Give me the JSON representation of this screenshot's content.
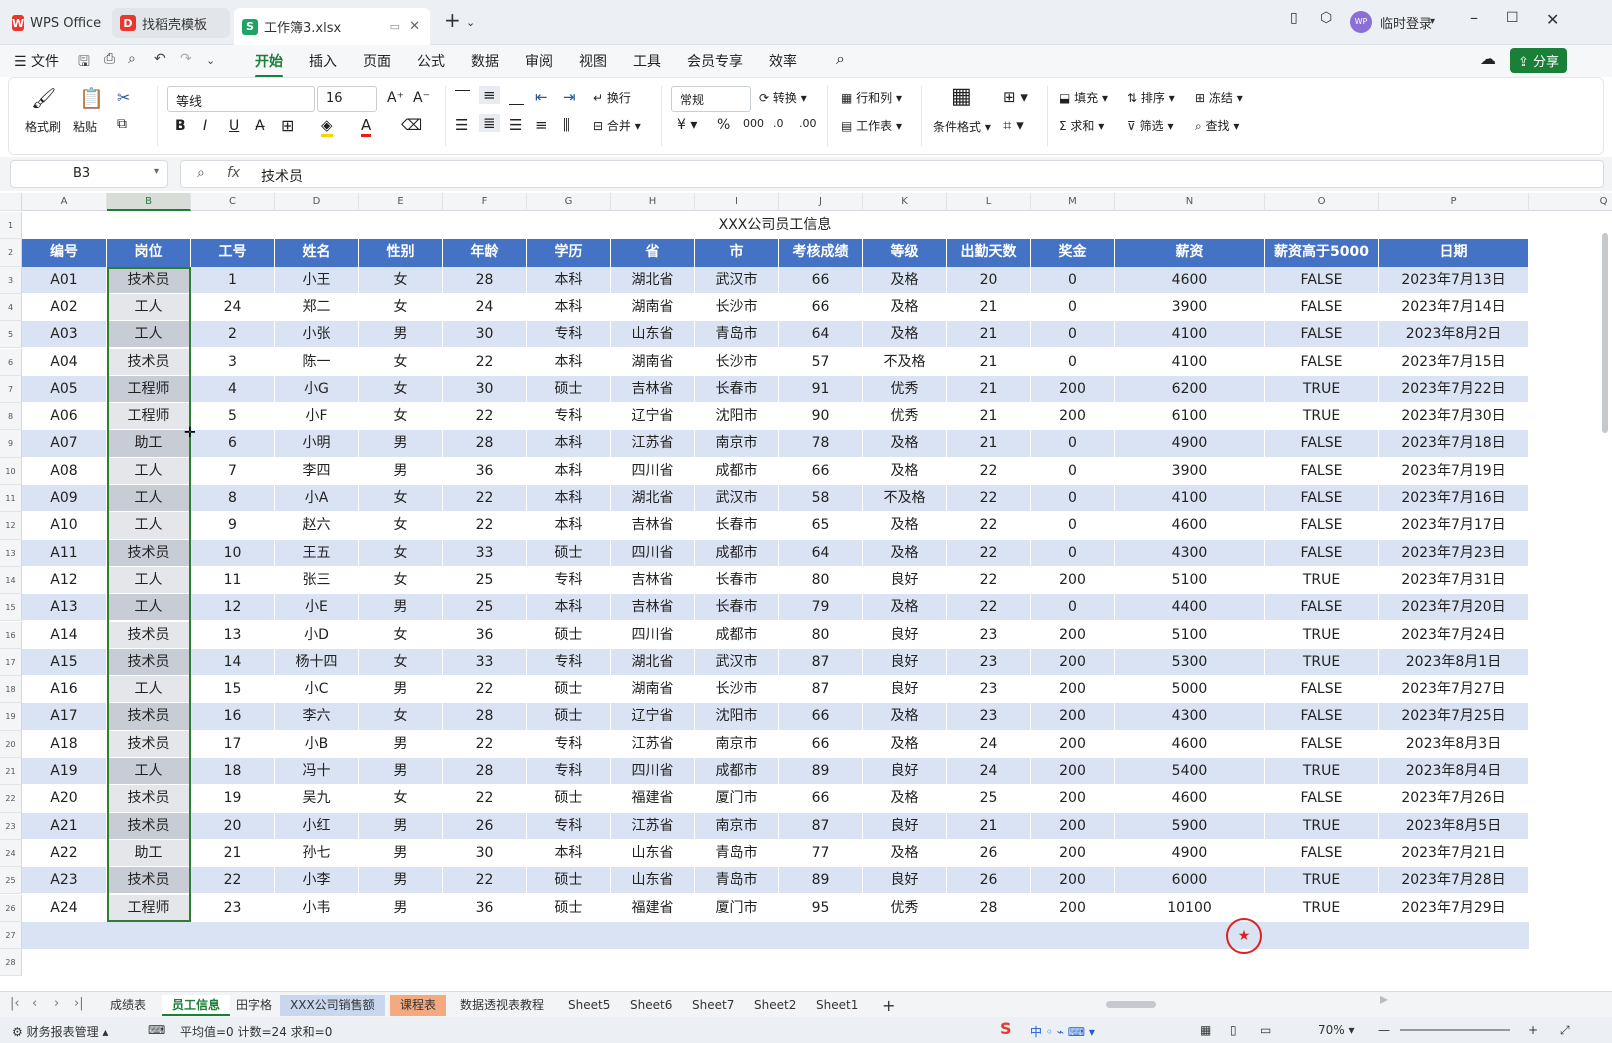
{
  "window": {
    "tabs": [
      {
        "label": "WPS Office",
        "icon": "wps-logo"
      },
      {
        "label": "找稻壳模板",
        "icon": "docer-logo"
      },
      {
        "label": "工作簿3.xlsx",
        "icon": "spreadsheet-logo",
        "active": true
      }
    ],
    "user_label": "临时登录",
    "avatar_text": "WP"
  },
  "menu": {
    "file_label": "文件",
    "items": [
      "开始",
      "插入",
      "页面",
      "公式",
      "数据",
      "审阅",
      "视图",
      "工具",
      "会员专享",
      "效率"
    ],
    "active": "开始",
    "share_label": "分享"
  },
  "ribbon": {
    "format_painter": "格式刷",
    "paste": "粘贴",
    "font_name": "等线",
    "font_size": "16",
    "wrap": "换行",
    "merge": "合并",
    "number_format": "常规",
    "convert": "转换",
    "rows_cols": "行和列",
    "worksheet": "工作表",
    "cond_format": "条件格式",
    "fill": "填充",
    "sort": "排序",
    "freeze": "冻结",
    "sum": "求和",
    "filter": "筛选",
    "find": "查找"
  },
  "formula": {
    "cell_ref": "B3",
    "fx_label": "fx",
    "value": "技术员"
  },
  "columns": [
    "A",
    "B",
    "C",
    "D",
    "E",
    "F",
    "G",
    "H",
    "I",
    "J",
    "K",
    "L",
    "M",
    "N",
    "O",
    "P",
    "Q"
  ],
  "sheet": {
    "title": "XXX公司员工信息",
    "headers": [
      "编号",
      "岗位",
      "工号",
      "姓名",
      "性别",
      "年龄",
      "学历",
      "省",
      "市",
      "考核成绩",
      "等级",
      "出勤天数",
      "奖金",
      "薪资",
      "薪资高于5000",
      "日期"
    ],
    "rows": [
      [
        "A01",
        "技术员",
        "1",
        "小王",
        "女",
        "28",
        "本科",
        "湖北省",
        "武汉市",
        "66",
        "及格",
        "20",
        "0",
        "4600",
        "FALSE",
        "2023年7月13日"
      ],
      [
        "A02",
        "工人",
        "24",
        "郑二",
        "女",
        "24",
        "本科",
        "湖南省",
        "长沙市",
        "66",
        "及格",
        "21",
        "0",
        "3900",
        "FALSE",
        "2023年7月14日"
      ],
      [
        "A03",
        "工人",
        "2",
        "小张",
        "男",
        "30",
        "专科",
        "山东省",
        "青岛市",
        "64",
        "及格",
        "21",
        "0",
        "4100",
        "FALSE",
        "2023年8月2日"
      ],
      [
        "A04",
        "技术员",
        "3",
        "陈一",
        "女",
        "22",
        "本科",
        "湖南省",
        "长沙市",
        "57",
        "不及格",
        "21",
        "0",
        "4100",
        "FALSE",
        "2023年7月15日"
      ],
      [
        "A05",
        "工程师",
        "4",
        "小G",
        "女",
        "30",
        "硕士",
        "吉林省",
        "长春市",
        "91",
        "优秀",
        "21",
        "200",
        "6200",
        "TRUE",
        "2023年7月22日"
      ],
      [
        "A06",
        "工程师",
        "5",
        "小F",
        "女",
        "22",
        "专科",
        "辽宁省",
        "沈阳市",
        "90",
        "优秀",
        "21",
        "200",
        "6100",
        "TRUE",
        "2023年7月30日"
      ],
      [
        "A07",
        "助工",
        "6",
        "小明",
        "男",
        "28",
        "本科",
        "江苏省",
        "南京市",
        "78",
        "及格",
        "21",
        "0",
        "4900",
        "FALSE",
        "2023年7月18日"
      ],
      [
        "A08",
        "工人",
        "7",
        "李四",
        "男",
        "36",
        "本科",
        "四川省",
        "成都市",
        "66",
        "及格",
        "22",
        "0",
        "3900",
        "FALSE",
        "2023年7月19日"
      ],
      [
        "A09",
        "工人",
        "8",
        "小A",
        "女",
        "22",
        "本科",
        "湖北省",
        "武汉市",
        "58",
        "不及格",
        "22",
        "0",
        "4100",
        "FALSE",
        "2023年7月16日"
      ],
      [
        "A10",
        "工人",
        "9",
        "赵六",
        "女",
        "22",
        "本科",
        "吉林省",
        "长春市",
        "65",
        "及格",
        "22",
        "0",
        "4600",
        "FALSE",
        "2023年7月17日"
      ],
      [
        "A11",
        "技术员",
        "10",
        "王五",
        "女",
        "33",
        "硕士",
        "四川省",
        "成都市",
        "64",
        "及格",
        "22",
        "0",
        "4300",
        "FALSE",
        "2023年7月23日"
      ],
      [
        "A12",
        "工人",
        "11",
        "张三",
        "女",
        "25",
        "专科",
        "吉林省",
        "长春市",
        "80",
        "良好",
        "22",
        "200",
        "5100",
        "TRUE",
        "2023年7月31日"
      ],
      [
        "A13",
        "工人",
        "12",
        "小E",
        "男",
        "25",
        "本科",
        "吉林省",
        "长春市",
        "79",
        "及格",
        "22",
        "0",
        "4400",
        "FALSE",
        "2023年7月20日"
      ],
      [
        "A14",
        "技术员",
        "13",
        "小D",
        "女",
        "36",
        "硕士",
        "四川省",
        "成都市",
        "80",
        "良好",
        "23",
        "200",
        "5100",
        "TRUE",
        "2023年7月24日"
      ],
      [
        "A15",
        "技术员",
        "14",
        "杨十四",
        "女",
        "33",
        "专科",
        "湖北省",
        "武汉市",
        "87",
        "良好",
        "23",
        "200",
        "5300",
        "TRUE",
        "2023年8月1日"
      ],
      [
        "A16",
        "工人",
        "15",
        "小C",
        "男",
        "22",
        "硕士",
        "湖南省",
        "长沙市",
        "87",
        "良好",
        "23",
        "200",
        "5000",
        "FALSE",
        "2023年7月27日"
      ],
      [
        "A17",
        "技术员",
        "16",
        "李六",
        "女",
        "28",
        "硕士",
        "辽宁省",
        "沈阳市",
        "66",
        "及格",
        "23",
        "200",
        "4300",
        "FALSE",
        "2023年7月25日"
      ],
      [
        "A18",
        "技术员",
        "17",
        "小B",
        "男",
        "22",
        "专科",
        "江苏省",
        "南京市",
        "66",
        "及格",
        "24",
        "200",
        "4600",
        "FALSE",
        "2023年8月3日"
      ],
      [
        "A19",
        "工人",
        "18",
        "冯十",
        "男",
        "28",
        "专科",
        "四川省",
        "成都市",
        "89",
        "良好",
        "24",
        "200",
        "5400",
        "TRUE",
        "2023年8月4日"
      ],
      [
        "A20",
        "技术员",
        "19",
        "吴九",
        "女",
        "22",
        "硕士",
        "福建省",
        "厦门市",
        "66",
        "及格",
        "25",
        "200",
        "4600",
        "FALSE",
        "2023年7月26日"
      ],
      [
        "A21",
        "技术员",
        "20",
        "小红",
        "男",
        "26",
        "专科",
        "江苏省",
        "南京市",
        "87",
        "良好",
        "21",
        "200",
        "5900",
        "TRUE",
        "2023年8月5日"
      ],
      [
        "A22",
        "助工",
        "21",
        "孙七",
        "男",
        "30",
        "本科",
        "山东省",
        "青岛市",
        "77",
        "及格",
        "26",
        "200",
        "4900",
        "FALSE",
        "2023年7月21日"
      ],
      [
        "A23",
        "技术员",
        "22",
        "小李",
        "男",
        "22",
        "硕士",
        "山东省",
        "青岛市",
        "89",
        "良好",
        "26",
        "200",
        "6000",
        "TRUE",
        "2023年7月28日"
      ],
      [
        "A24",
        "工程师",
        "23",
        "小韦",
        "男",
        "36",
        "硕士",
        "福建省",
        "厦门市",
        "95",
        "优秀",
        "28",
        "200",
        "10100",
        "TRUE",
        "2023年7月29日"
      ]
    ]
  },
  "sheet_tabs": [
    "成绩表",
    "员工信息",
    "田字格",
    "XXX公司销售额",
    "课程表",
    "数据透视表教程",
    "Sheet5",
    "Sheet6",
    "Sheet7",
    "Sheet2",
    "Sheet1"
  ],
  "active_sheet": "员工信息",
  "status": {
    "macro_label": "财务报表管理",
    "stats": "平均值=0  计数=24  求和=0",
    "zoom": "70%"
  },
  "colors": {
    "accent": "#1a7f37",
    "header_fill": "#4472c4",
    "row_band": "#dae3f3",
    "selection": "#2e7d32"
  }
}
